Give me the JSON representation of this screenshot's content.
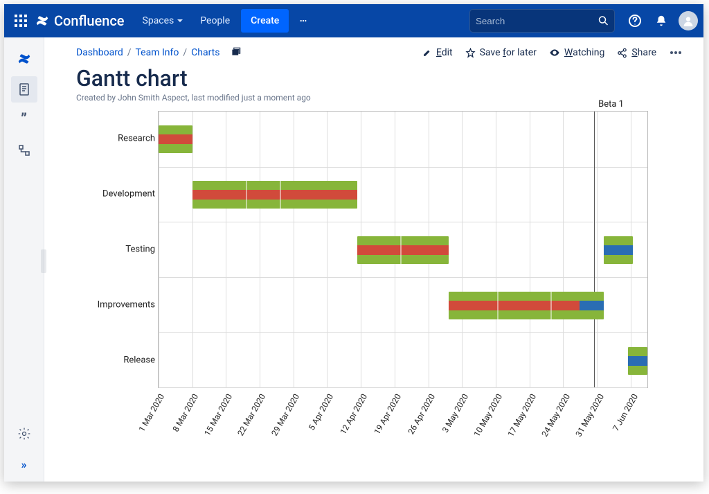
{
  "app": {
    "name": "Confluence"
  },
  "topnav": {
    "spaces": "Spaces",
    "people": "People",
    "create": "Create",
    "search_placeholder": "Search"
  },
  "breadcrumbs": {
    "items": [
      "Dashboard",
      "Team Info",
      "Charts"
    ]
  },
  "page": {
    "title": "Gantt chart",
    "byline": "Created by John Smith Aspect, last modified just a moment ago"
  },
  "actions": {
    "edit": "Edit",
    "save": "Save for later",
    "watch": "Watching",
    "share": "Share"
  },
  "chart_data": {
    "type": "gantt",
    "x_ticks": [
      "1 Mar 2020",
      "8 Mar 2020",
      "15 Mar 2020",
      "22 Mar 2020",
      "29 Mar 2020",
      "5 Apr 2020",
      "12 Apr 2020",
      "19 Apr 2020",
      "26 Apr 2020",
      "3 May 2020",
      "10 May 2020",
      "17 May 2020",
      "24 May 2020",
      "31 May 2020",
      "7 Jun 2020"
    ],
    "x_range": [
      "2020-03-01",
      "2020-06-10"
    ],
    "rows": [
      "Research",
      "Development",
      "Testing",
      "Improvements",
      "Release"
    ],
    "markers": [
      {
        "label": "Beta 1",
        "date": "2020-05-30"
      }
    ],
    "tasks": [
      {
        "row": "Research",
        "start": "2020-03-01",
        "end": "2020-03-08",
        "inner": "red"
      },
      {
        "row": "Development",
        "start": "2020-03-08",
        "end": "2020-04-11",
        "inner": "red",
        "segments": [
          "2020-03-19",
          "2020-03-26"
        ]
      },
      {
        "row": "Testing",
        "start": "2020-04-11",
        "end": "2020-04-30",
        "inner": "red",
        "segments": [
          "2020-04-20"
        ]
      },
      {
        "row": "Testing",
        "start": "2020-06-01",
        "end": "2020-06-07",
        "inner": "blue"
      },
      {
        "row": "Improvements",
        "start": "2020-04-30",
        "end": "2020-06-01",
        "inner": "red",
        "blue_end": "2020-05-27",
        "segments": [
          "2020-05-10",
          "2020-05-21"
        ]
      },
      {
        "row": "Release",
        "start": "2020-06-06",
        "end": "2020-06-10",
        "inner": "blue"
      }
    ]
  }
}
